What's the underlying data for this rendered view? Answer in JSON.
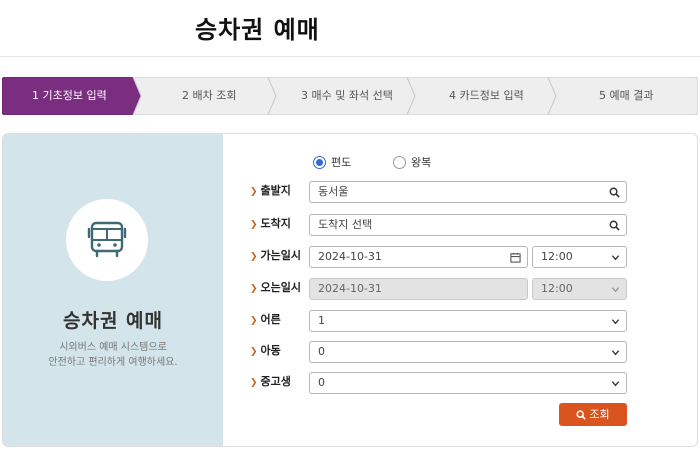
{
  "page": {
    "title": "승차권 예매"
  },
  "steps": [
    {
      "label": "1 기초정보 입력",
      "active": true
    },
    {
      "label": "2 배차 조회",
      "active": false
    },
    {
      "label": "3 매수 및 좌석 선택",
      "active": false
    },
    {
      "label": "4 카드정보 입력",
      "active": false
    },
    {
      "label": "5 예매 결과",
      "active": false
    }
  ],
  "colors": {
    "active_step": "#7a2e7f",
    "step_bg": "#eeeeee",
    "panel_bg": "#d3e5ea",
    "accent": "#d9541e",
    "radio": "#2f6bd8"
  },
  "panel": {
    "icon": "bus-icon",
    "title": "승차권 예매",
    "desc_line1": "시외버스 예매 시스템으로",
    "desc_line2": "안전하고 편리하게 여행하세요."
  },
  "form": {
    "trip_type": {
      "one_way": "편도",
      "round_trip": "왕복",
      "selected": "편도"
    },
    "departure": {
      "label": "출발지",
      "value": "동서울"
    },
    "arrival": {
      "label": "도착지",
      "placeholder": "도착지 선택"
    },
    "depart_date": {
      "label": "가는일시",
      "date": "2024-10-31",
      "time": "12:00"
    },
    "return_date": {
      "label": "오는일시",
      "date": "2024-10-31",
      "time": "12:00",
      "disabled": true
    },
    "adult": {
      "label": "어른",
      "value": "1"
    },
    "child": {
      "label": "아동",
      "value": "0"
    },
    "student": {
      "label": "중고생",
      "value": "0"
    },
    "search_button": "조회"
  }
}
